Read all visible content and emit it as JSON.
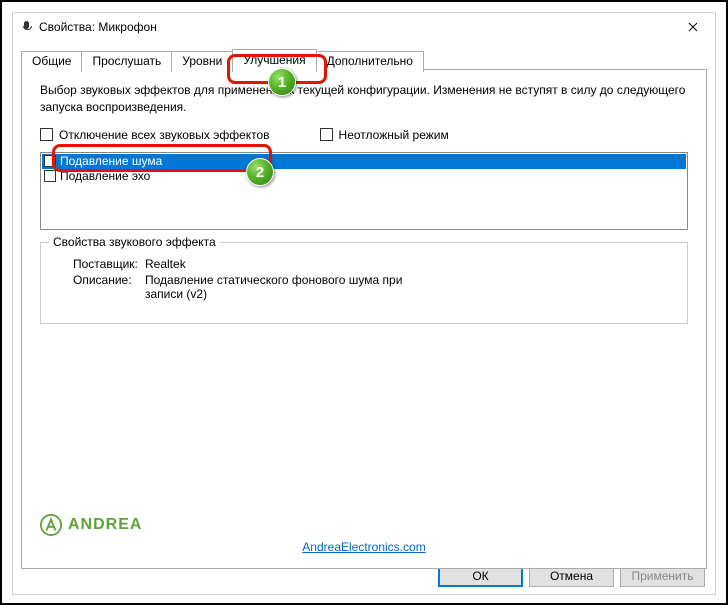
{
  "titlebar": {
    "title": "Свойства: Микрофон"
  },
  "tabs": {
    "general": "Общие",
    "listen": "Прослушать",
    "levels": "Уровни",
    "enhancements": "Улучшения",
    "advanced": "Дополнительно"
  },
  "panel": {
    "description": "Выбор звуковых эффектов для применения к текущей конфигурации. Изменения не вступят в силу до следующего запуска воспроизведения.",
    "disable_all": "Отключение всех звуковых эффектов",
    "immediate_mode": "Неотложный режим",
    "effects": [
      "Подавление шума",
      "Подавление эхо"
    ],
    "properties_legend": "Свойства звукового эффекта",
    "provider_label": "Поставщик:",
    "provider_value": "Realtek",
    "desc_label": "Описание:",
    "desc_value": "Подавление статического фонового шума при записи (v2)"
  },
  "logo_text": "ANDREA",
  "link": "AndreaElectronics.com",
  "buttons": {
    "ok": "ОК",
    "cancel": "Отмена",
    "apply": "Применить"
  },
  "markers": {
    "one": "1",
    "two": "2"
  }
}
